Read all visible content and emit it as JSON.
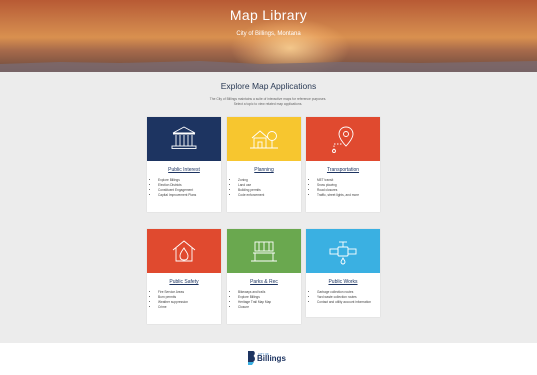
{
  "hero": {
    "title": "Map Library",
    "subtitle": "City of Billings, Montana"
  },
  "explore": {
    "heading": "Explore Map Applications",
    "intro_line1": "The City of Billings maintains a suite of interactive maps for reference purposes.",
    "intro_line2": "Select a topic to view related map applications."
  },
  "cards": [
    {
      "title": "Public Interest",
      "color": "#1d3461",
      "icon": "building-columns-icon",
      "items": [
        "Explore Billings",
        "Election Districts",
        "Constituent Engagement",
        "Capital Improvement Plans"
      ]
    },
    {
      "title": "Planning",
      "color": "#f7c62f",
      "icon": "house-tree-icon",
      "items": [
        "Zoning",
        "Land use",
        "Building permits",
        "Code enforcement"
      ]
    },
    {
      "title": "Transportation",
      "color": "#e04a2f",
      "icon": "map-pin-route-icon",
      "items": [
        "MET transit",
        "Snow plowing",
        "Road closures",
        "Traffic, street lights, and more"
      ]
    },
    {
      "title": "Public Safety",
      "color": "#e04a2f",
      "icon": "house-fire-icon",
      "items": [
        "Fire Service Areas",
        "Burn permits",
        "Weather suppression",
        "Crime"
      ]
    },
    {
      "title": "Parks & Rec",
      "color": "#6aa84f",
      "icon": "park-bench-icon",
      "items": [
        "Bikeways and trails",
        "Explore Billings",
        "Heritage Trail Map Map",
        "Closure"
      ]
    },
    {
      "title": "Public Works",
      "color": "#3ab0e2",
      "icon": "water-valve-icon",
      "items": [
        "Garbage collection routes",
        "Yard waste collection routes",
        "Contact and utility account information"
      ]
    }
  ],
  "footer": {
    "logo_small": "CITY OF",
    "logo_big": "Billings",
    "logo_icon": "billings-logo-icon"
  }
}
